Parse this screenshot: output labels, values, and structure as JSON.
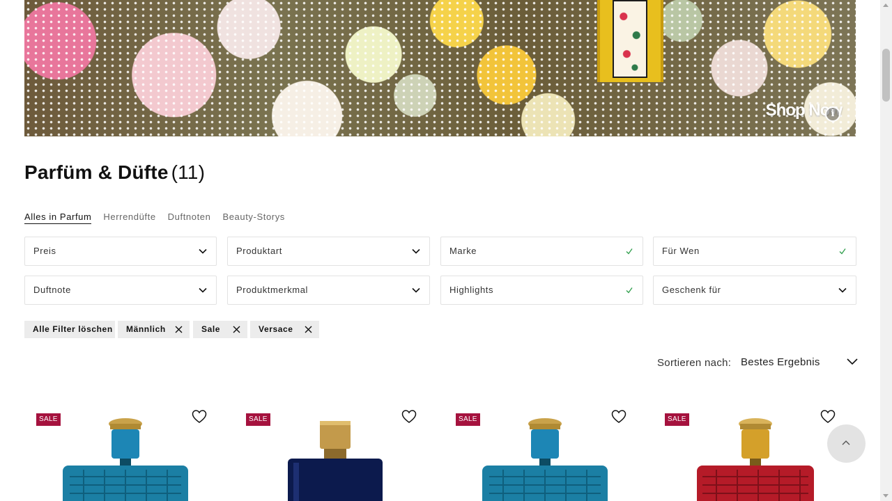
{
  "hero": {
    "cta": "Shop Now",
    "info_icon": "info-icon"
  },
  "page": {
    "title": "Parfüm & Düfte",
    "count": "(11)"
  },
  "tabs": [
    {
      "label": "Alles in Parfum",
      "active": true
    },
    {
      "label": "Herrendüfte"
    },
    {
      "label": "Duftnoten"
    },
    {
      "label": "Beauty-Storys"
    }
  ],
  "filters": {
    "preis": "Preis",
    "produktart": "Produktart",
    "marke": "Marke",
    "fuer_wen": "Für Wen",
    "duftnote": "Duftnote",
    "produktmerkmal": "Produktmerkmal",
    "highlights": "Highlights",
    "geschenk_fuer": "Geschenk für"
  },
  "chips": {
    "clear": "Alle Filter löschen",
    "active": [
      "Männlich",
      "Sale",
      "Versace"
    ]
  },
  "sort": {
    "label": "Sortieren nach:",
    "value": "Bestes Ergebnis"
  },
  "products": [
    {
      "badge": "SALE"
    },
    {
      "badge": "SALE"
    },
    {
      "badge": "SALE"
    },
    {
      "badge": "SALE"
    }
  ],
  "colors": {
    "sale": "#a5123e",
    "check": "#2e9e4b",
    "chip": "#ececec"
  }
}
